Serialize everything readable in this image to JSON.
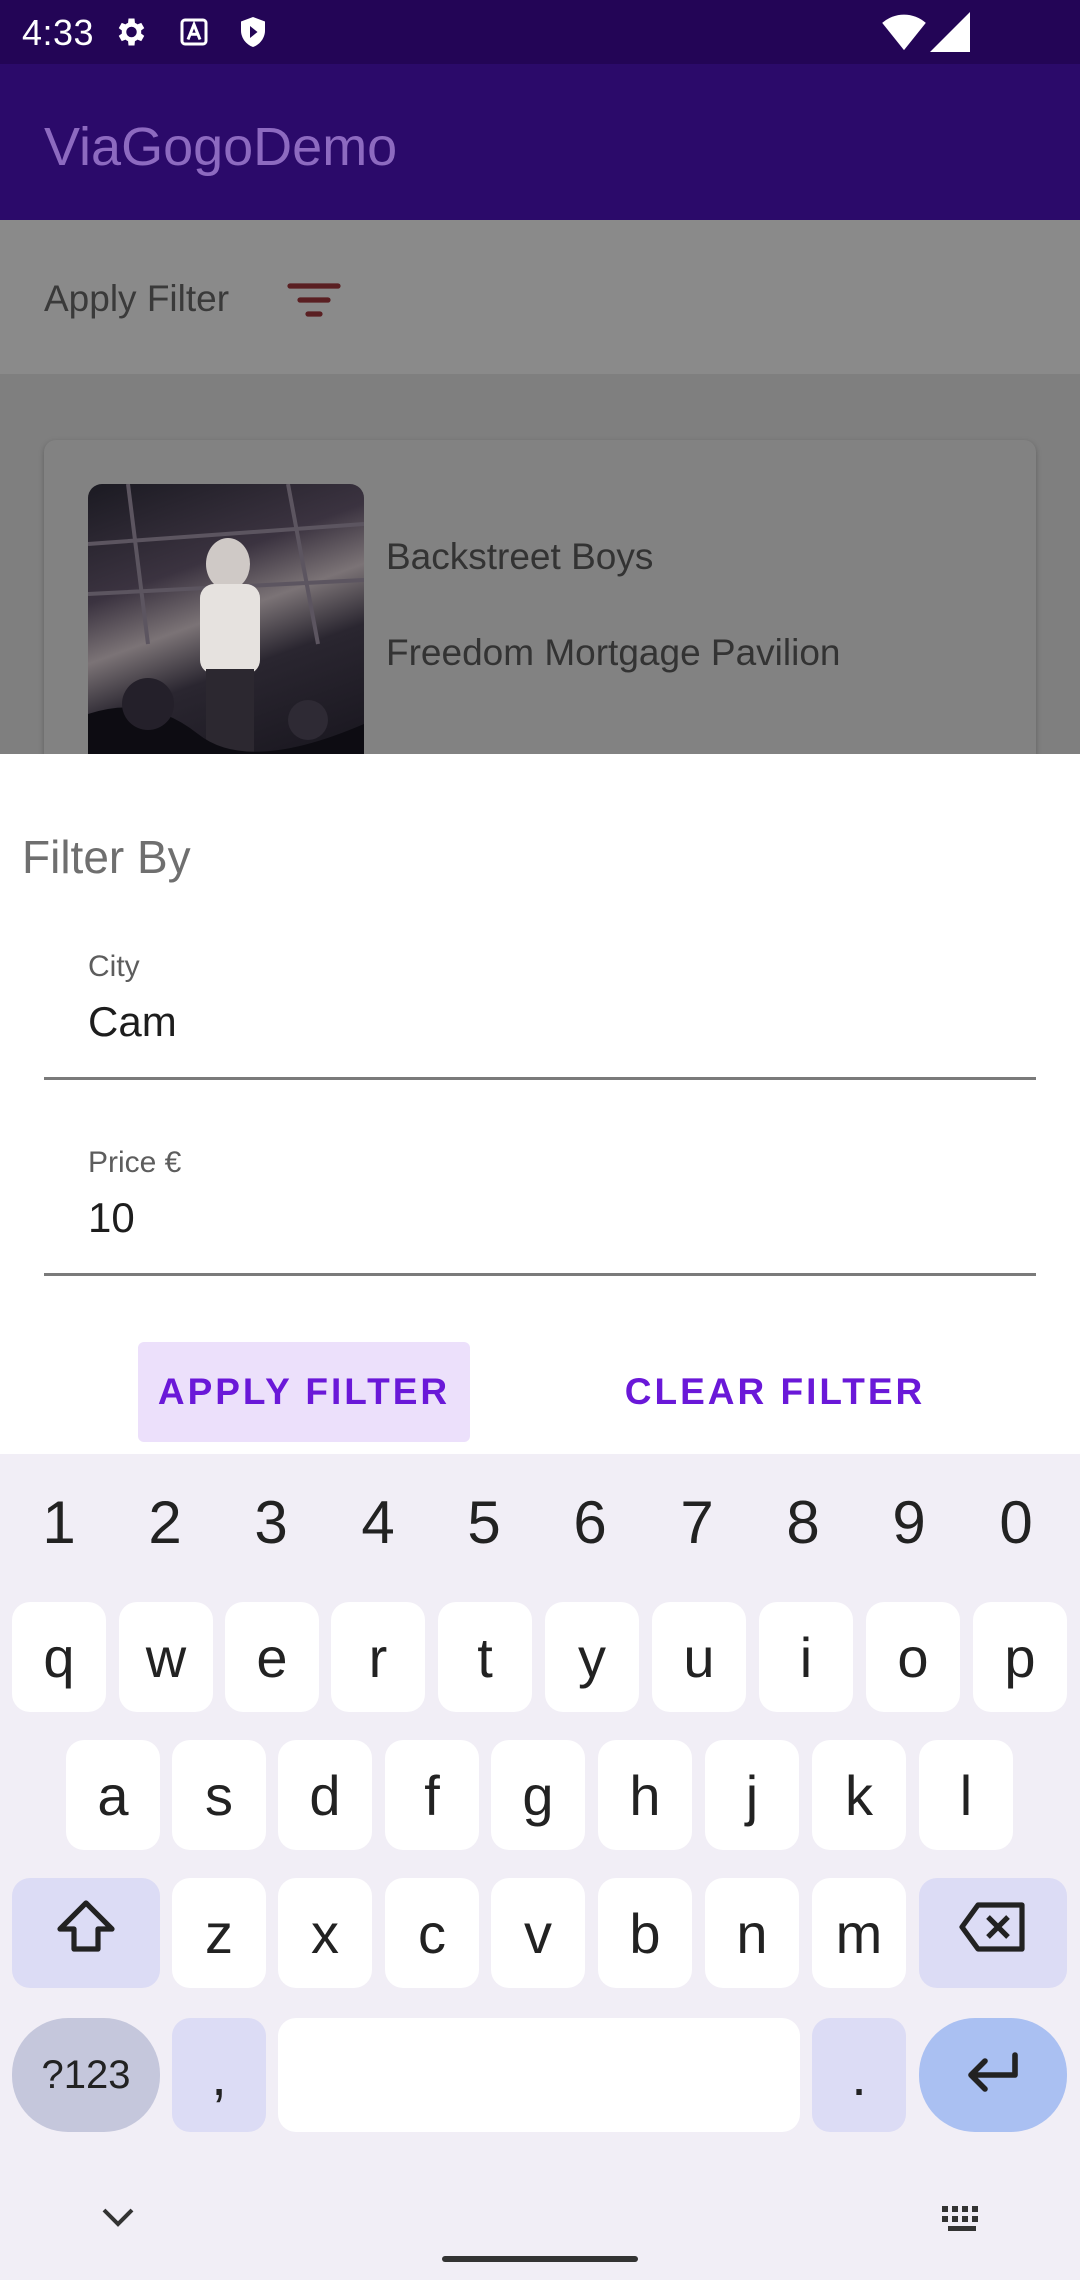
{
  "status_bar": {
    "time": "4:33",
    "left_icons": [
      "settings-icon",
      "font-icon",
      "shield-icon"
    ],
    "right_icons": [
      "wifi-icon",
      "cell-signal-icon"
    ]
  },
  "app_bar": {
    "title": "ViaGogoDemo"
  },
  "filter_bar": {
    "label": "Apply Filter",
    "icon": "filter-list-icon"
  },
  "event_card": {
    "title": "Backstreet Boys",
    "venue": "Freedom Mortgage Pavilion"
  },
  "filter_sheet": {
    "title": "Filter By",
    "city": {
      "label": "City",
      "value": "Cam"
    },
    "price": {
      "label": "Price €",
      "value": "10"
    },
    "apply_label": "APPLY FILTER",
    "clear_label": "CLEAR FILTER"
  },
  "keyboard": {
    "numbers": [
      "1",
      "2",
      "3",
      "4",
      "5",
      "6",
      "7",
      "8",
      "9",
      "0"
    ],
    "row1": [
      "q",
      "w",
      "e",
      "r",
      "t",
      "y",
      "u",
      "i",
      "o",
      "p"
    ],
    "row2": [
      "a",
      "s",
      "d",
      "f",
      "g",
      "h",
      "j",
      "k",
      "l"
    ],
    "row3": [
      "z",
      "x",
      "c",
      "v",
      "b",
      "n",
      "m"
    ],
    "symbols_label": "?123",
    "comma": ",",
    "period": ".",
    "icons": [
      "shift-icon",
      "backspace-icon",
      "enter-icon",
      "hide-keyboard-icon",
      "keyboard-switch-icon"
    ]
  },
  "colors": {
    "status_bar": "#230556",
    "app_bar": "#2b0a6a",
    "accent": "#6a18d8",
    "apply_button_bg": "#ece0fb",
    "keyboard_bg": "#f1eef6"
  }
}
